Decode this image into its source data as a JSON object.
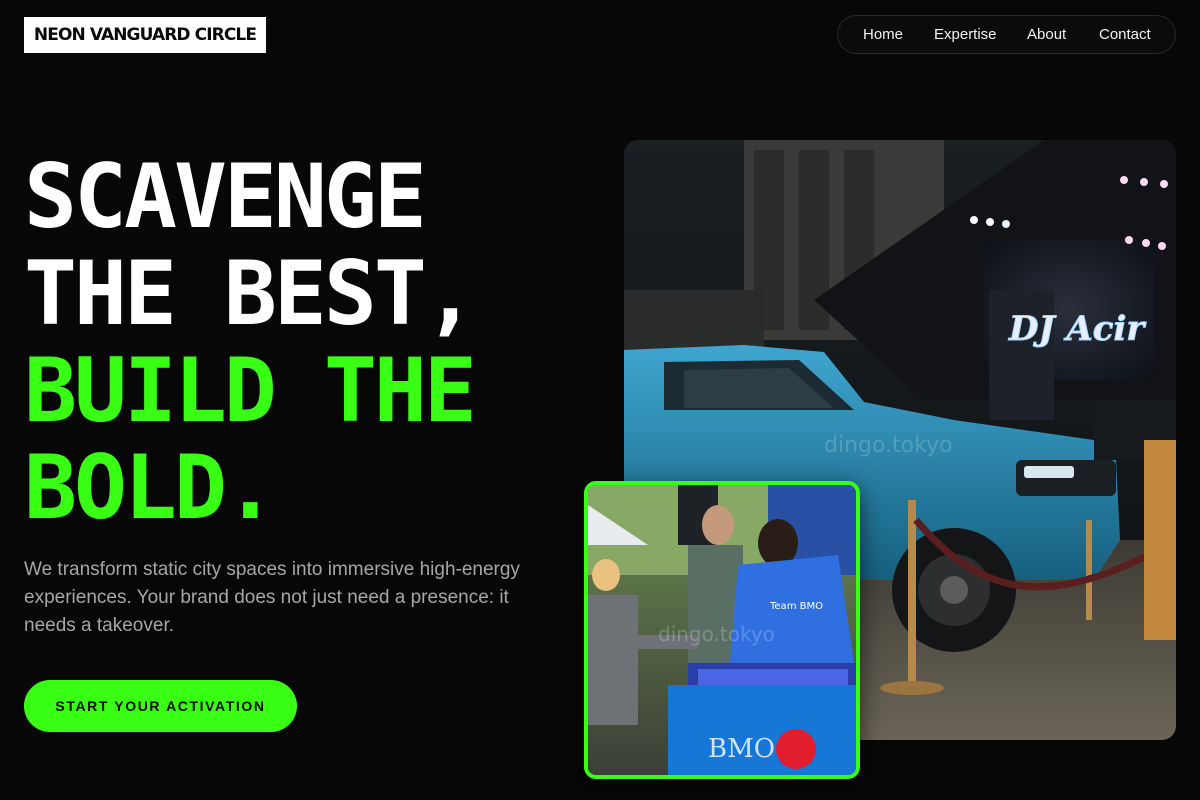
{
  "brand": {
    "logo_text": "NEON VANGUARD CIRCLE"
  },
  "nav": {
    "items": [
      {
        "label": "Home"
      },
      {
        "label": "Expertise"
      },
      {
        "label": "About"
      },
      {
        "label": "Contact"
      }
    ]
  },
  "hero": {
    "headline": {
      "line1": "SCAVENGE",
      "line2": "THE BEST,",
      "line3": "BUILD THE",
      "line4": "BOLD."
    },
    "description": "We transform static city spaces into immersive high-energy experiences. Your brand does not just need a presence: it needs a takeover.",
    "cta_label": "START YOUR ACTIVATION"
  },
  "images": {
    "main": {
      "stage_sign_text": "DJ Acir",
      "watermark": "dingo.tokyo"
    },
    "inset": {
      "tablecloth_text": "BMO",
      "shirt_text": "Team BMO",
      "watermark": "dingo.tokyo"
    }
  },
  "colors": {
    "accent": "#39ff14",
    "background": "#070707",
    "text_muted": "#a6a6a6"
  }
}
